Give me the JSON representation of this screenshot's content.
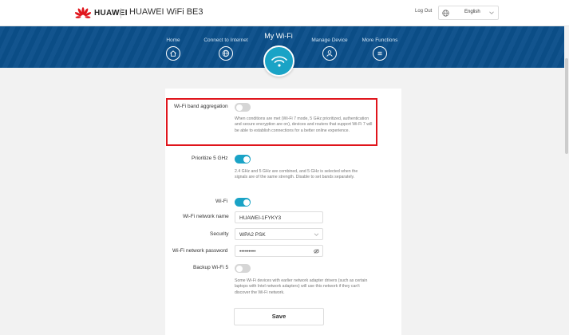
{
  "header": {
    "brand": "HUAWEI",
    "product": "HUAWEI WiFi BE3",
    "logout": "Log Out",
    "language": "English"
  },
  "nav": {
    "home": "Home",
    "connect": "Connect to Internet",
    "my_wifi": "My Wi-Fi",
    "manage": "Manage Device",
    "more": "More Functions"
  },
  "settings": {
    "band_aggregation": {
      "label": "Wi-Fi band aggregation",
      "enabled": false,
      "desc": "When conditions are met (Wi-Fi 7 mode, 5 GHz prioritized, authentication and secure encryption are on), devices and routers that support Wi-Fi 7 will be able to establish connections for a better online experience."
    },
    "prioritize_5ghz": {
      "label": "Prioritize 5 GHz",
      "enabled": true,
      "desc": "2.4 GHz and 5 GHz are combined, and 5 GHz is selected when the signals are of the same strength. Disable to set bands separately."
    },
    "wifi": {
      "label": "Wi-Fi",
      "enabled": true
    },
    "network_name": {
      "label": "Wi-Fi network name",
      "value": "HUAWEI-1FYKY3"
    },
    "security": {
      "label": "Security",
      "value": "WPA2 PSK"
    },
    "password": {
      "label": "Wi-Fi network password",
      "value": "•••••••••"
    },
    "backup_wifi5": {
      "label": "Backup Wi-Fi 5",
      "enabled": false,
      "desc": "Some Wi-Fi devices with earlier network adapter drivers (such as certain laptops with Intel network adapters) will use this network if they can't discover the Wi-Fi network."
    },
    "save": "Save"
  },
  "colors": {
    "nav_bg": "#0b4f8a",
    "accent": "#1aa3c6",
    "highlight": "#e0151c"
  }
}
